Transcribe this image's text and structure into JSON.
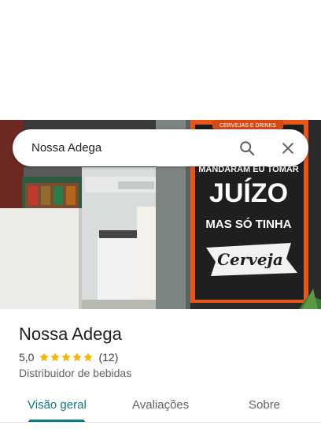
{
  "search": {
    "query": "Nossa Adega"
  },
  "photo": {
    "sign_banner": "CERVEJAS E DRINKS",
    "sign_line1": "MANDARAM EU TOMAR",
    "sign_line2": "JUÍZO",
    "sign_line3": "MAS SÓ TINHA",
    "sign_line4": "Cerveja"
  },
  "place": {
    "name": "Nossa Adega",
    "rating": "5,0",
    "stars": 5,
    "review_count": "(12)",
    "category": "Distribuidor de bebidas"
  },
  "tabs": [
    {
      "label": "Visão geral",
      "active": true
    },
    {
      "label": "Avaliações",
      "active": false
    },
    {
      "label": "Sobre",
      "active": false
    }
  ],
  "colors": {
    "accent": "#0b7a83",
    "star": "#f4b400",
    "sign_orange": "#e8561c"
  }
}
